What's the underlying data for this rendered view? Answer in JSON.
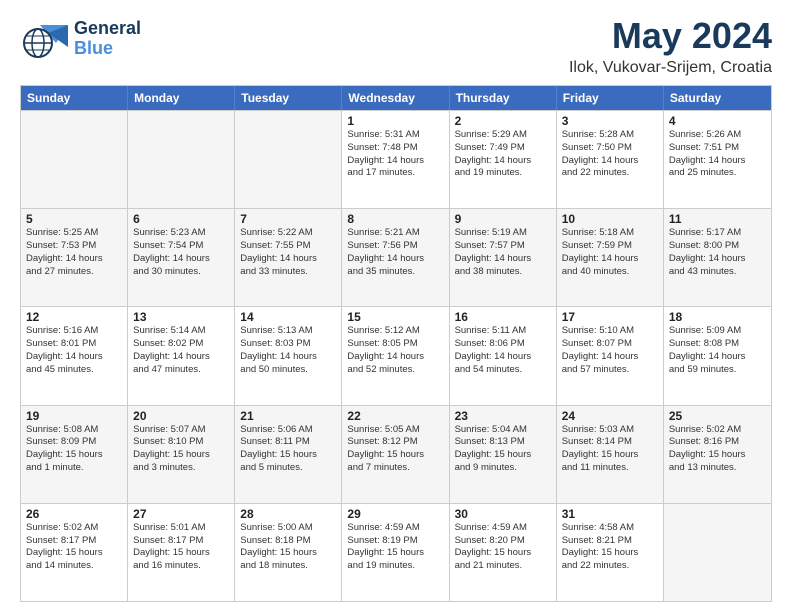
{
  "header": {
    "logo_general": "General",
    "logo_blue": "Blue",
    "title": "May 2024",
    "subtitle": "Ilok, Vukovar-Srijem, Croatia"
  },
  "calendar": {
    "days": [
      "Sunday",
      "Monday",
      "Tuesday",
      "Wednesday",
      "Thursday",
      "Friday",
      "Saturday"
    ],
    "rows": [
      [
        {
          "day": "",
          "empty": true
        },
        {
          "day": "",
          "empty": true
        },
        {
          "day": "",
          "empty": true
        },
        {
          "day": "1",
          "line1": "Sunrise: 5:31 AM",
          "line2": "Sunset: 7:48 PM",
          "line3": "Daylight: 14 hours",
          "line4": "and 17 minutes."
        },
        {
          "day": "2",
          "line1": "Sunrise: 5:29 AM",
          "line2": "Sunset: 7:49 PM",
          "line3": "Daylight: 14 hours",
          "line4": "and 19 minutes."
        },
        {
          "day": "3",
          "line1": "Sunrise: 5:28 AM",
          "line2": "Sunset: 7:50 PM",
          "line3": "Daylight: 14 hours",
          "line4": "and 22 minutes."
        },
        {
          "day": "4",
          "line1": "Sunrise: 5:26 AM",
          "line2": "Sunset: 7:51 PM",
          "line3": "Daylight: 14 hours",
          "line4": "and 25 minutes."
        }
      ],
      [
        {
          "day": "5",
          "line1": "Sunrise: 5:25 AM",
          "line2": "Sunset: 7:53 PM",
          "line3": "Daylight: 14 hours",
          "line4": "and 27 minutes."
        },
        {
          "day": "6",
          "line1": "Sunrise: 5:23 AM",
          "line2": "Sunset: 7:54 PM",
          "line3": "Daylight: 14 hours",
          "line4": "and 30 minutes."
        },
        {
          "day": "7",
          "line1": "Sunrise: 5:22 AM",
          "line2": "Sunset: 7:55 PM",
          "line3": "Daylight: 14 hours",
          "line4": "and 33 minutes."
        },
        {
          "day": "8",
          "line1": "Sunrise: 5:21 AM",
          "line2": "Sunset: 7:56 PM",
          "line3": "Daylight: 14 hours",
          "line4": "and 35 minutes."
        },
        {
          "day": "9",
          "line1": "Sunrise: 5:19 AM",
          "line2": "Sunset: 7:57 PM",
          "line3": "Daylight: 14 hours",
          "line4": "and 38 minutes."
        },
        {
          "day": "10",
          "line1": "Sunrise: 5:18 AM",
          "line2": "Sunset: 7:59 PM",
          "line3": "Daylight: 14 hours",
          "line4": "and 40 minutes."
        },
        {
          "day": "11",
          "line1": "Sunrise: 5:17 AM",
          "line2": "Sunset: 8:00 PM",
          "line3": "Daylight: 14 hours",
          "line4": "and 43 minutes."
        }
      ],
      [
        {
          "day": "12",
          "line1": "Sunrise: 5:16 AM",
          "line2": "Sunset: 8:01 PM",
          "line3": "Daylight: 14 hours",
          "line4": "and 45 minutes."
        },
        {
          "day": "13",
          "line1": "Sunrise: 5:14 AM",
          "line2": "Sunset: 8:02 PM",
          "line3": "Daylight: 14 hours",
          "line4": "and 47 minutes."
        },
        {
          "day": "14",
          "line1": "Sunrise: 5:13 AM",
          "line2": "Sunset: 8:03 PM",
          "line3": "Daylight: 14 hours",
          "line4": "and 50 minutes."
        },
        {
          "day": "15",
          "line1": "Sunrise: 5:12 AM",
          "line2": "Sunset: 8:05 PM",
          "line3": "Daylight: 14 hours",
          "line4": "and 52 minutes."
        },
        {
          "day": "16",
          "line1": "Sunrise: 5:11 AM",
          "line2": "Sunset: 8:06 PM",
          "line3": "Daylight: 14 hours",
          "line4": "and 54 minutes."
        },
        {
          "day": "17",
          "line1": "Sunrise: 5:10 AM",
          "line2": "Sunset: 8:07 PM",
          "line3": "Daylight: 14 hours",
          "line4": "and 57 minutes."
        },
        {
          "day": "18",
          "line1": "Sunrise: 5:09 AM",
          "line2": "Sunset: 8:08 PM",
          "line3": "Daylight: 14 hours",
          "line4": "and 59 minutes."
        }
      ],
      [
        {
          "day": "19",
          "line1": "Sunrise: 5:08 AM",
          "line2": "Sunset: 8:09 PM",
          "line3": "Daylight: 15 hours",
          "line4": "and 1 minute."
        },
        {
          "day": "20",
          "line1": "Sunrise: 5:07 AM",
          "line2": "Sunset: 8:10 PM",
          "line3": "Daylight: 15 hours",
          "line4": "and 3 minutes."
        },
        {
          "day": "21",
          "line1": "Sunrise: 5:06 AM",
          "line2": "Sunset: 8:11 PM",
          "line3": "Daylight: 15 hours",
          "line4": "and 5 minutes."
        },
        {
          "day": "22",
          "line1": "Sunrise: 5:05 AM",
          "line2": "Sunset: 8:12 PM",
          "line3": "Daylight: 15 hours",
          "line4": "and 7 minutes."
        },
        {
          "day": "23",
          "line1": "Sunrise: 5:04 AM",
          "line2": "Sunset: 8:13 PM",
          "line3": "Daylight: 15 hours",
          "line4": "and 9 minutes."
        },
        {
          "day": "24",
          "line1": "Sunrise: 5:03 AM",
          "line2": "Sunset: 8:14 PM",
          "line3": "Daylight: 15 hours",
          "line4": "and 11 minutes."
        },
        {
          "day": "25",
          "line1": "Sunrise: 5:02 AM",
          "line2": "Sunset: 8:16 PM",
          "line3": "Daylight: 15 hours",
          "line4": "and 13 minutes."
        }
      ],
      [
        {
          "day": "26",
          "line1": "Sunrise: 5:02 AM",
          "line2": "Sunset: 8:17 PM",
          "line3": "Daylight: 15 hours",
          "line4": "and 14 minutes."
        },
        {
          "day": "27",
          "line1": "Sunrise: 5:01 AM",
          "line2": "Sunset: 8:17 PM",
          "line3": "Daylight: 15 hours",
          "line4": "and 16 minutes."
        },
        {
          "day": "28",
          "line1": "Sunrise: 5:00 AM",
          "line2": "Sunset: 8:18 PM",
          "line3": "Daylight: 15 hours",
          "line4": "and 18 minutes."
        },
        {
          "day": "29",
          "line1": "Sunrise: 4:59 AM",
          "line2": "Sunset: 8:19 PM",
          "line3": "Daylight: 15 hours",
          "line4": "and 19 minutes."
        },
        {
          "day": "30",
          "line1": "Sunrise: 4:59 AM",
          "line2": "Sunset: 8:20 PM",
          "line3": "Daylight: 15 hours",
          "line4": "and 21 minutes."
        },
        {
          "day": "31",
          "line1": "Sunrise: 4:58 AM",
          "line2": "Sunset: 8:21 PM",
          "line3": "Daylight: 15 hours",
          "line4": "and 22 minutes."
        },
        {
          "day": "",
          "empty": true
        }
      ]
    ]
  }
}
